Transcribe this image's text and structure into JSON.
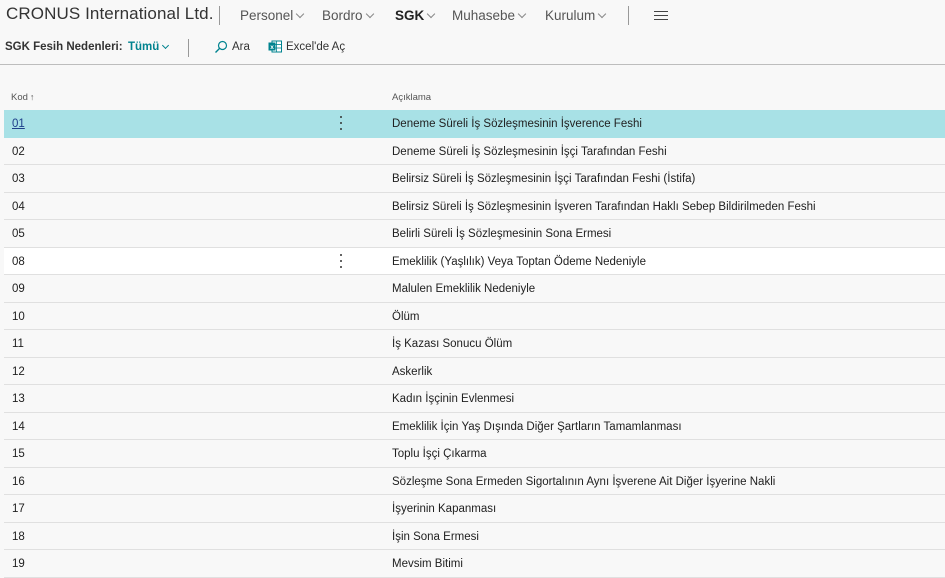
{
  "app": {
    "company": "CRONUS International Ltd."
  },
  "nav": {
    "items": [
      {
        "label": "Personel"
      },
      {
        "label": "Bordro"
      },
      {
        "label": "SGK"
      },
      {
        "label": "Muhasebe"
      },
      {
        "label": "Kurulum"
      }
    ]
  },
  "actionbar": {
    "title": "SGK Fesih Nedenleri:",
    "filter": "Tümü",
    "search": "Ara",
    "excel": "Excel'de Aç"
  },
  "table": {
    "headers": {
      "kod": "Kod",
      "kod_sort": "↑",
      "aciklama": "Açıklama"
    },
    "rows": [
      {
        "kod": "01",
        "aciklama": "Deneme Süreli İş Sözleşmesinin İşverence Feshi"
      },
      {
        "kod": "02",
        "aciklama": "Deneme Süreli İş Sözleşmesinin İşçi Tarafından Feshi"
      },
      {
        "kod": "03",
        "aciklama": "Belirsiz Süreli İş Sözleşmesinin İşçi Tarafından Feshi (İstifa)"
      },
      {
        "kod": "04",
        "aciklama": "Belirsiz Süreli İş Sözleşmesinin İşveren Tarafından Haklı Sebep Bildirilmeden Feshi"
      },
      {
        "kod": "05",
        "aciklama": "Belirli Süreli İş Sözleşmesinin Sona Ermesi"
      },
      {
        "kod": "08",
        "aciklama": "Emeklilik (Yaşlılık) Veya Toptan Ödeme Nedeniyle"
      },
      {
        "kod": "09",
        "aciklama": "Malulen Emeklilik Nedeniyle"
      },
      {
        "kod": "10",
        "aciklama": "Ölüm"
      },
      {
        "kod": "11",
        "aciklama": "İş Kazası Sonucu Ölüm"
      },
      {
        "kod": "12",
        "aciklama": "Askerlik"
      },
      {
        "kod": "13",
        "aciklama": "Kadın İşçinin Evlenmesi"
      },
      {
        "kod": "14",
        "aciklama": "Emeklilik İçin Yaş Dışında Diğer Şartların Tamamlanması"
      },
      {
        "kod": "15",
        "aciklama": "Toplu İşçi Çıkarma"
      },
      {
        "kod": "16",
        "aciklama": "Sözleşme Sona Ermeden Sigortalının Aynı İşverene Ait Diğer İşyerine Nakli"
      },
      {
        "kod": "17",
        "aciklama": "İşyerinin Kapanması"
      },
      {
        "kod": "18",
        "aciklama": "İşin Sona Ermesi"
      },
      {
        "kod": "19",
        "aciklama": "Mevsim Bitimi"
      }
    ]
  },
  "colors": {
    "accent": "#00838f",
    "selected_row": "#a8e1e6"
  },
  "icons": {
    "search": "search-icon",
    "excel": "excel-icon",
    "menu": "hamburger-menu-icon",
    "row_menu": "more-vertical-icon"
  }
}
